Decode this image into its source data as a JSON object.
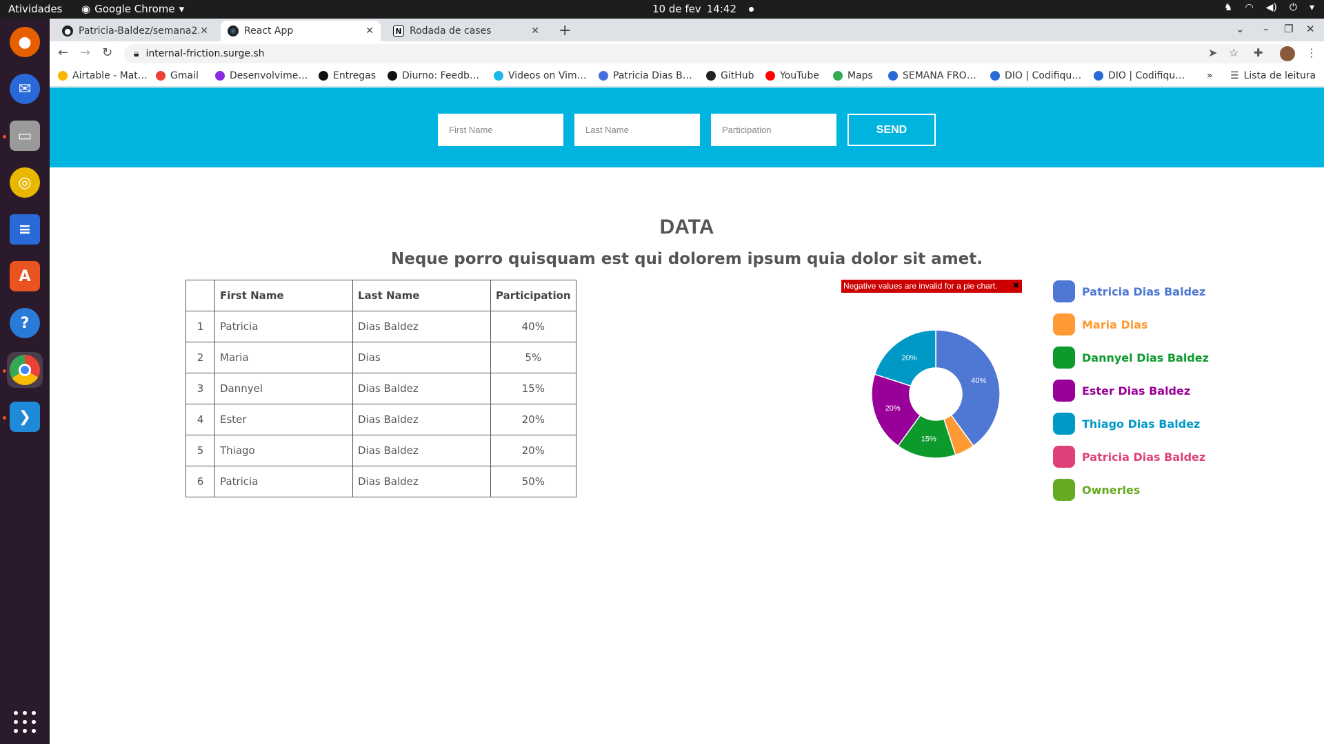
{
  "topbar": {
    "activities": "Atividades",
    "app_name": "Google Chrome",
    "date": "10 de fev",
    "time": "14:42"
  },
  "dock": {
    "items": [
      {
        "name": "firefox-icon",
        "color": "#e66000"
      },
      {
        "name": "thunderbird-icon",
        "color": "#2a6ad8"
      },
      {
        "name": "files-icon",
        "color": "#9a9a9a"
      },
      {
        "name": "rhythmbox-icon",
        "color": "#e8b800"
      },
      {
        "name": "writer-icon",
        "color": "#2a6ad8"
      },
      {
        "name": "software-center-icon",
        "color": "#e95420"
      },
      {
        "name": "help-icon",
        "color": "#2a7ad8"
      },
      {
        "name": "chrome-icon",
        "color": "#4285f4"
      },
      {
        "name": "vscode-icon",
        "color": "#1f8ad8"
      }
    ]
  },
  "browser": {
    "tabs": [
      {
        "title": "Patricia-Baldez/semana2…",
        "favicon": "github-icon"
      },
      {
        "title": "React App",
        "favicon": "react-icon"
      },
      {
        "title": "Rodada de cases",
        "favicon": "notion-icon"
      }
    ],
    "url": "internal-friction.surge.sh",
    "bookmarks": [
      {
        "label": "Airtable - Mat…",
        "color": "#fcb400"
      },
      {
        "label": "Gmail",
        "color": "#ea4335"
      },
      {
        "label": "Desenvolvime…",
        "color": "#8a2be2"
      },
      {
        "label": "Entregas",
        "color": "#111111"
      },
      {
        "label": "Diurno: Feedb…",
        "color": "#111111"
      },
      {
        "label": "Videos on Vim…",
        "color": "#1ab7ea"
      },
      {
        "label": "Patricia Dias B…",
        "color": "#4a6ee0"
      },
      {
        "label": "GitHub",
        "color": "#222222"
      },
      {
        "label": "YouTube",
        "color": "#ff0000"
      },
      {
        "label": "Maps",
        "color": "#34a853"
      },
      {
        "label": "SEMANA FRO…",
        "color": "#2a6ad8"
      },
      {
        "label": "DIO | Codifiqu…",
        "color": "#2a6ad8"
      },
      {
        "label": "DIO | Codifiqu…",
        "color": "#2a6ad8"
      }
    ],
    "more": "»",
    "reading_list": "Lista de leitura"
  },
  "form": {
    "first_name_placeholder": "First Name",
    "last_name_placeholder": "Last Name",
    "participation_placeholder": "Participation",
    "send_label": "SEND"
  },
  "content": {
    "title": "DATA",
    "subtitle": "Neque porro quisquam est qui dolorem ipsum quia dolor sit amet."
  },
  "table": {
    "headers": [
      "",
      "First Name",
      "Last Name",
      "Participation"
    ],
    "rows": [
      {
        "n": "1",
        "first": "Patricia",
        "last": "Dias Baldez",
        "pct": "40%"
      },
      {
        "n": "2",
        "first": "Maria",
        "last": "Dias",
        "pct": "5%"
      },
      {
        "n": "3",
        "first": "Dannyel",
        "last": "Dias Baldez",
        "pct": "15%"
      },
      {
        "n": "4",
        "first": "Ester",
        "last": "Dias Baldez",
        "pct": "20%"
      },
      {
        "n": "5",
        "first": "Thiago",
        "last": "Dias Baldez",
        "pct": "20%"
      },
      {
        "n": "6",
        "first": "Patricia",
        "last": "Dias Baldez",
        "pct": "50%"
      }
    ]
  },
  "error_message": "Negative values are invalid for a pie chart.",
  "chart_data": {
    "type": "pie",
    "donut": true,
    "slices": [
      {
        "name": "Patricia Dias Baldez",
        "value": 40,
        "label": "40%",
        "color": "#4e78d4"
      },
      {
        "name": "Maria Dias",
        "value": 5,
        "label": "",
        "color": "#ff9933"
      },
      {
        "name": "Dannyel Dias Baldez",
        "value": 15,
        "label": "15%",
        "color": "#0d9a2d"
      },
      {
        "name": "Ester Dias Baldez",
        "value": 20,
        "label": "20%",
        "color": "#990099"
      },
      {
        "name": "Thiago Dias Baldez",
        "value": 20,
        "label": "20%",
        "color": "#0099c6"
      }
    ],
    "legend": [
      {
        "name": "Patricia Dias Baldez",
        "color": "#4e78d4"
      },
      {
        "name": "Maria Dias",
        "color": "#ff9933"
      },
      {
        "name": "Dannyel Dias Baldez",
        "color": "#0d9a2d"
      },
      {
        "name": "Ester Dias Baldez",
        "color": "#990099"
      },
      {
        "name": "Thiago Dias Baldez",
        "color": "#0099c6"
      },
      {
        "name": "Patricia Dias Baldez",
        "color": "#e0407a"
      },
      {
        "name": "Ownerles",
        "color": "#66aa22"
      }
    ]
  }
}
